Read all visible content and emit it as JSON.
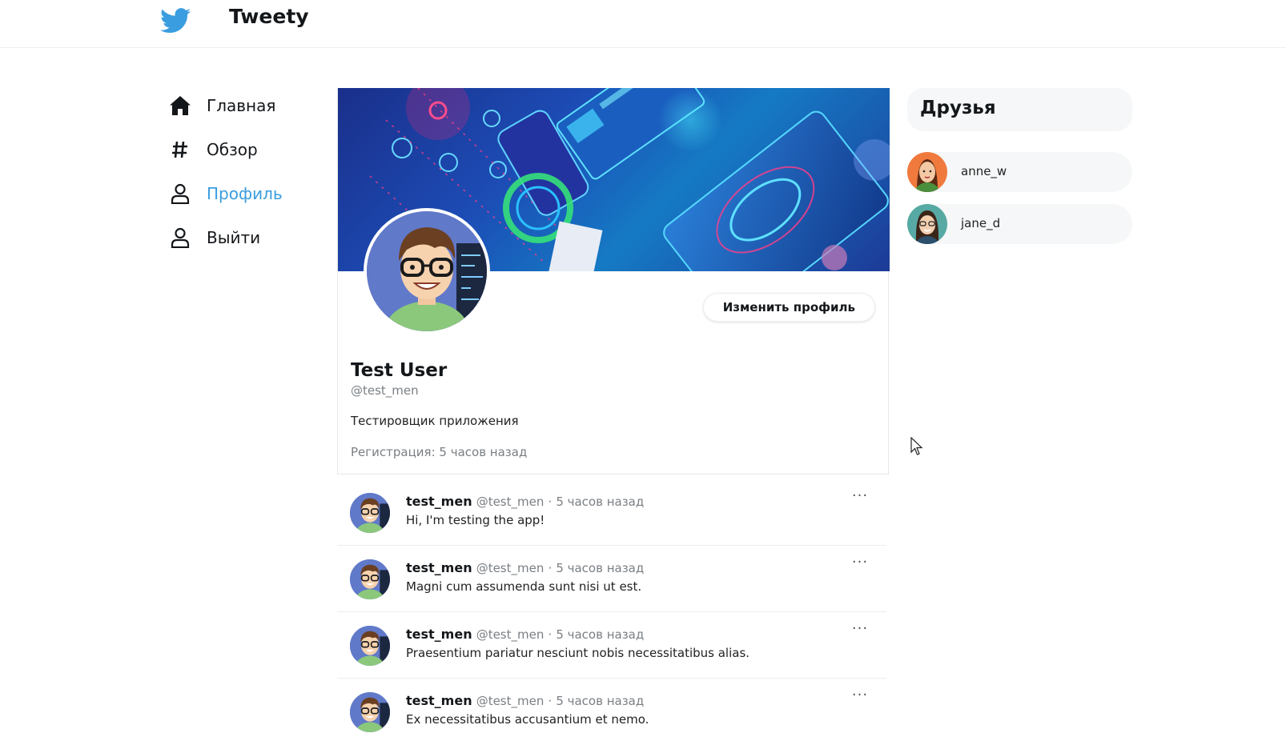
{
  "app": {
    "title": "Tweety",
    "accent_color": "#3a9de0",
    "logo_icon": "twitter-bird-icon"
  },
  "nav": {
    "items": [
      {
        "label": "Главная",
        "icon": "home-icon",
        "active": false
      },
      {
        "label": "Обзор",
        "icon": "hash-icon",
        "active": false
      },
      {
        "label": "Профиль",
        "icon": "user-icon",
        "active": true
      },
      {
        "label": "Выйти",
        "icon": "user-icon",
        "active": false
      }
    ]
  },
  "profile": {
    "name": "Test User",
    "handle": "@test_men",
    "bio": "Тестировщик приложения",
    "registered": "Регистрация: 5 часов назад",
    "edit_label": "Изменить профиль"
  },
  "tweets": [
    {
      "user": "test_men",
      "handle": "@test_men",
      "sep": "·",
      "time": "5 часов назад",
      "text": "Hi, I'm testing the app!",
      "more": "···"
    },
    {
      "user": "test_men",
      "handle": "@test_men",
      "sep": "·",
      "time": "5 часов назад",
      "text": "Magni cum assumenda sunt nisi ut est.",
      "more": "···"
    },
    {
      "user": "test_men",
      "handle": "@test_men",
      "sep": "·",
      "time": "5 часов назад",
      "text": "Praesentium pariatur nesciunt nobis necessitatibus alias.",
      "more": "···"
    },
    {
      "user": "test_men",
      "handle": "@test_men",
      "sep": "·",
      "time": "5 часов назад",
      "text": "Ex necessitatibus accusantium et nemo.",
      "more": "···"
    }
  ],
  "friends": {
    "title": "Друзья",
    "list": [
      {
        "name": "anne_w"
      },
      {
        "name": "jane_d"
      }
    ]
  }
}
